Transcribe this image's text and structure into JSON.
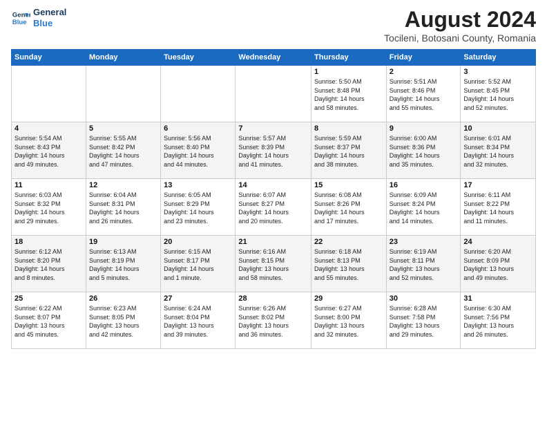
{
  "logo": {
    "line1": "General",
    "line2": "Blue"
  },
  "title": "August 2024",
  "subtitle": "Tocileni, Botosani County, Romania",
  "days_of_week": [
    "Sunday",
    "Monday",
    "Tuesday",
    "Wednesday",
    "Thursday",
    "Friday",
    "Saturday"
  ],
  "weeks": [
    [
      {
        "day": "",
        "info": ""
      },
      {
        "day": "",
        "info": ""
      },
      {
        "day": "",
        "info": ""
      },
      {
        "day": "",
        "info": ""
      },
      {
        "day": "1",
        "info": "Sunrise: 5:50 AM\nSunset: 8:48 PM\nDaylight: 14 hours\nand 58 minutes."
      },
      {
        "day": "2",
        "info": "Sunrise: 5:51 AM\nSunset: 8:46 PM\nDaylight: 14 hours\nand 55 minutes."
      },
      {
        "day": "3",
        "info": "Sunrise: 5:52 AM\nSunset: 8:45 PM\nDaylight: 14 hours\nand 52 minutes."
      }
    ],
    [
      {
        "day": "4",
        "info": "Sunrise: 5:54 AM\nSunset: 8:43 PM\nDaylight: 14 hours\nand 49 minutes."
      },
      {
        "day": "5",
        "info": "Sunrise: 5:55 AM\nSunset: 8:42 PM\nDaylight: 14 hours\nand 47 minutes."
      },
      {
        "day": "6",
        "info": "Sunrise: 5:56 AM\nSunset: 8:40 PM\nDaylight: 14 hours\nand 44 minutes."
      },
      {
        "day": "7",
        "info": "Sunrise: 5:57 AM\nSunset: 8:39 PM\nDaylight: 14 hours\nand 41 minutes."
      },
      {
        "day": "8",
        "info": "Sunrise: 5:59 AM\nSunset: 8:37 PM\nDaylight: 14 hours\nand 38 minutes."
      },
      {
        "day": "9",
        "info": "Sunrise: 6:00 AM\nSunset: 8:36 PM\nDaylight: 14 hours\nand 35 minutes."
      },
      {
        "day": "10",
        "info": "Sunrise: 6:01 AM\nSunset: 8:34 PM\nDaylight: 14 hours\nand 32 minutes."
      }
    ],
    [
      {
        "day": "11",
        "info": "Sunrise: 6:03 AM\nSunset: 8:32 PM\nDaylight: 14 hours\nand 29 minutes."
      },
      {
        "day": "12",
        "info": "Sunrise: 6:04 AM\nSunset: 8:31 PM\nDaylight: 14 hours\nand 26 minutes."
      },
      {
        "day": "13",
        "info": "Sunrise: 6:05 AM\nSunset: 8:29 PM\nDaylight: 14 hours\nand 23 minutes."
      },
      {
        "day": "14",
        "info": "Sunrise: 6:07 AM\nSunset: 8:27 PM\nDaylight: 14 hours\nand 20 minutes."
      },
      {
        "day": "15",
        "info": "Sunrise: 6:08 AM\nSunset: 8:26 PM\nDaylight: 14 hours\nand 17 minutes."
      },
      {
        "day": "16",
        "info": "Sunrise: 6:09 AM\nSunset: 8:24 PM\nDaylight: 14 hours\nand 14 minutes."
      },
      {
        "day": "17",
        "info": "Sunrise: 6:11 AM\nSunset: 8:22 PM\nDaylight: 14 hours\nand 11 minutes."
      }
    ],
    [
      {
        "day": "18",
        "info": "Sunrise: 6:12 AM\nSunset: 8:20 PM\nDaylight: 14 hours\nand 8 minutes."
      },
      {
        "day": "19",
        "info": "Sunrise: 6:13 AM\nSunset: 8:19 PM\nDaylight: 14 hours\nand 5 minutes."
      },
      {
        "day": "20",
        "info": "Sunrise: 6:15 AM\nSunset: 8:17 PM\nDaylight: 14 hours\nand 1 minute."
      },
      {
        "day": "21",
        "info": "Sunrise: 6:16 AM\nSunset: 8:15 PM\nDaylight: 13 hours\nand 58 minutes."
      },
      {
        "day": "22",
        "info": "Sunrise: 6:18 AM\nSunset: 8:13 PM\nDaylight: 13 hours\nand 55 minutes."
      },
      {
        "day": "23",
        "info": "Sunrise: 6:19 AM\nSunset: 8:11 PM\nDaylight: 13 hours\nand 52 minutes."
      },
      {
        "day": "24",
        "info": "Sunrise: 6:20 AM\nSunset: 8:09 PM\nDaylight: 13 hours\nand 49 minutes."
      }
    ],
    [
      {
        "day": "25",
        "info": "Sunrise: 6:22 AM\nSunset: 8:07 PM\nDaylight: 13 hours\nand 45 minutes."
      },
      {
        "day": "26",
        "info": "Sunrise: 6:23 AM\nSunset: 8:05 PM\nDaylight: 13 hours\nand 42 minutes."
      },
      {
        "day": "27",
        "info": "Sunrise: 6:24 AM\nSunset: 8:04 PM\nDaylight: 13 hours\nand 39 minutes."
      },
      {
        "day": "28",
        "info": "Sunrise: 6:26 AM\nSunset: 8:02 PM\nDaylight: 13 hours\nand 36 minutes."
      },
      {
        "day": "29",
        "info": "Sunrise: 6:27 AM\nSunset: 8:00 PM\nDaylight: 13 hours\nand 32 minutes."
      },
      {
        "day": "30",
        "info": "Sunrise: 6:28 AM\nSunset: 7:58 PM\nDaylight: 13 hours\nand 29 minutes."
      },
      {
        "day": "31",
        "info": "Sunrise: 6:30 AM\nSunset: 7:56 PM\nDaylight: 13 hours\nand 26 minutes."
      }
    ]
  ]
}
